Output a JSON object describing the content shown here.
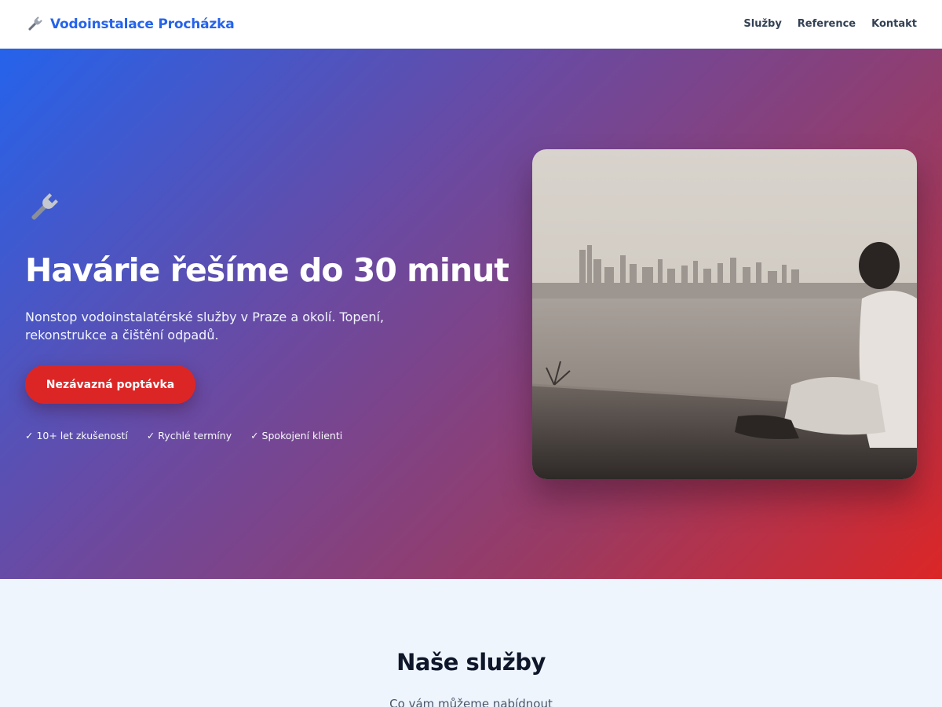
{
  "header": {
    "brand_icon": "wrench-icon",
    "brand_name": "Vodoinstalace Procházka",
    "nav": [
      "Služby",
      "Reference",
      "Kontakt"
    ]
  },
  "hero": {
    "icon": "wrench-icon",
    "title": "Havárie řešíme do 30 minut",
    "subtitle": "Nonstop vodoinstalatérské služby v Praze a okolí. Topení, rekonstrukce a čištění odpadů.",
    "cta_label": "Nezávazná poptávka",
    "badges": [
      "✓ 10+ let zkušeností",
      "✓ Rychlé termíny",
      "✓ Spokojení klienti"
    ],
    "image": "photo of a man sitting on a pier wall looking at a city skyline across the water"
  },
  "services": {
    "title": "Naše služby",
    "subtitle": "Co vám můžeme nabídnout"
  },
  "colors": {
    "brand": "#2563eb",
    "accent": "#dc2626",
    "gradient_start": "#2563eb",
    "gradient_end": "#dc2626",
    "section_bg": "#eff5fd"
  }
}
